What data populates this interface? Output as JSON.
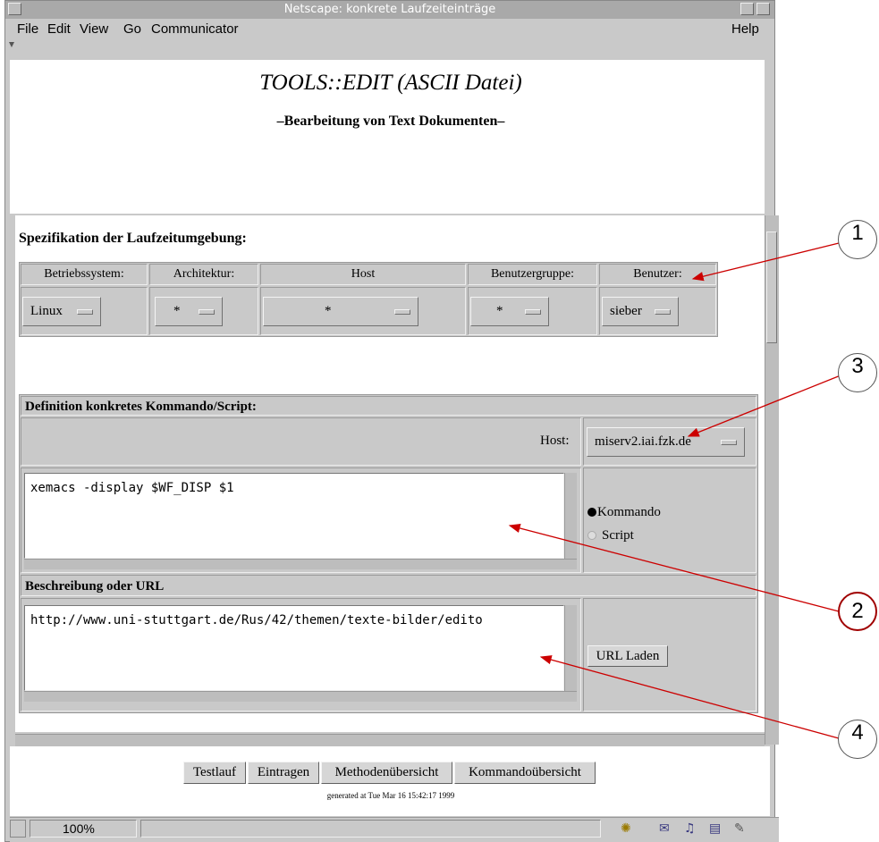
{
  "window": {
    "title": "Netscape: konkrete Laufzeiteinträge"
  },
  "menu": {
    "items": [
      "File",
      "Edit",
      "View",
      "Go",
      "Communicator"
    ],
    "help": "Help"
  },
  "header": {
    "title": "TOOLS::EDIT (ASCII Datei)",
    "subtitle": "–Bearbeitung von Text Dokumenten–"
  },
  "runtime": {
    "heading": "Spezifikation der Laufzeitumgebung:",
    "columns": [
      "Betriebssystem:",
      "Architektur:",
      "Host",
      "Benutzergruppe:",
      "Benutzer:"
    ],
    "values": [
      "Linux",
      "*",
      "*",
      "*",
      "sieber"
    ]
  },
  "definition": {
    "heading": "Definition konkretes Kommando/Script:",
    "host_label": "Host:",
    "host_value": "miserv2.iai.fzk.de",
    "command_text": "xemacs -display $WF_DISP $1",
    "radio_kommando": "Kommando",
    "radio_script": "Script",
    "selected_radio": "Kommando"
  },
  "description": {
    "heading": "Beschreibung oder URL",
    "url_text": "http://www.uni-stuttgart.de/Rus/42/themen/texte-bilder/edito",
    "load_button": "URL Laden"
  },
  "actions": {
    "buttons": [
      "Testlauf",
      "Eintragen",
      "Methodenübersicht",
      "Kommandoübersicht"
    ],
    "generated": "generated at Tue Mar 16 15:42:17 1999"
  },
  "status": {
    "zoom": "100%"
  },
  "callouts": [
    "1",
    "3",
    "2",
    "4"
  ],
  "colors": {
    "window_bg": "#c9c9c9",
    "callout_arrow": "#cc0000"
  }
}
